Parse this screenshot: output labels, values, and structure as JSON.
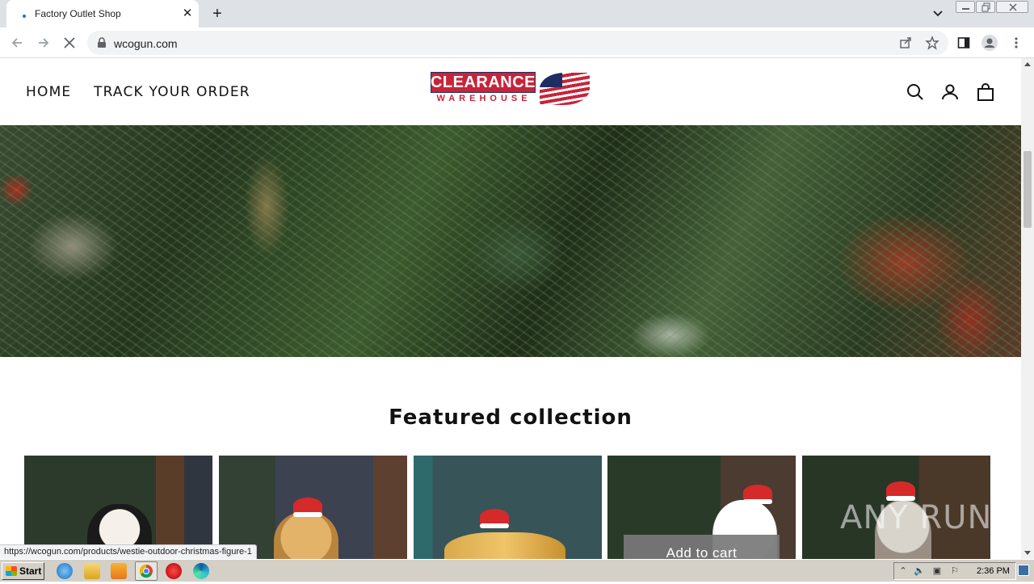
{
  "browser": {
    "tab_title": "Factory Outlet Shop",
    "close_glyph": "✕",
    "new_tab_glyph": "+",
    "url": "wcogun.com",
    "status_url": "https://wcogun.com/products/westie-outdoor-christmas-figure-1"
  },
  "header": {
    "nav": [
      {
        "label": "HOME"
      },
      {
        "label": "TRACK YOUR ORDER"
      }
    ],
    "logo": {
      "line1": "CLEARANCE",
      "line2": "WAREHOUSE"
    }
  },
  "main": {
    "section_title": "Featured collection",
    "add_to_cart_label": "Add to cart"
  },
  "watermark": "ANY RUN",
  "taskbar": {
    "start_label": "Start",
    "clock": "2:36 PM"
  },
  "colors": {
    "brand_red": "#c7243a",
    "brand_navy": "#1c2f62",
    "link_blue": "#1a73e8"
  }
}
